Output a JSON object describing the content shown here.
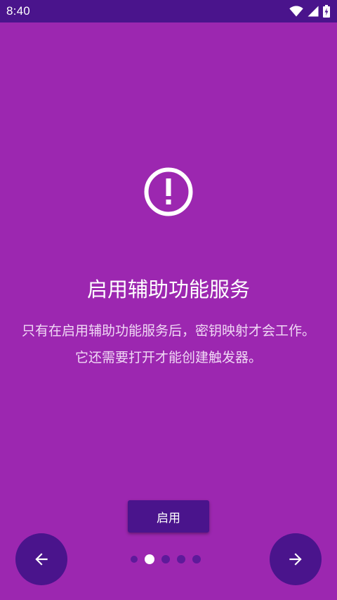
{
  "status_bar": {
    "time": "8:40",
    "icons": [
      "wifi-icon",
      "signal-icon",
      "battery-charging-icon"
    ]
  },
  "slide": {
    "icon": "alert-circle-icon",
    "title": "启用辅助功能服务",
    "description": "只有在启用辅助功能服务后，密钥映射才会工作。它还需要打开才能创建触发器。",
    "action_label": "启用"
  },
  "pager": {
    "total": 5,
    "current": 2
  },
  "navigation": {
    "prev_icon": "arrow-left-icon",
    "next_icon": "arrow-right-icon"
  },
  "colors": {
    "background": "#9c27b0",
    "primary_dark": "#4a148c",
    "text": "#ffffff"
  }
}
